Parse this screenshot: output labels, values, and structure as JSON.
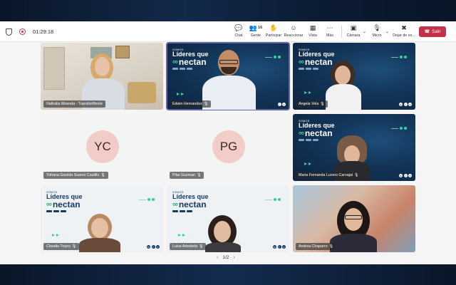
{
  "toolbar": {
    "timer": "01:29:18",
    "chat_label": "Chat",
    "people_count": "16",
    "people_label": "Gente",
    "raise_label": "Participar",
    "react_label": "Reaccionar",
    "view_label": "Vista",
    "more_label": "Más",
    "camera_label": "Cámara",
    "mic_label": "Micro",
    "share_label": "Dejar de co...",
    "leave_label": "Salir"
  },
  "brand": {
    "small": "SOMOS",
    "line1": "Líderes que",
    "line2": "nectan"
  },
  "participants": [
    {
      "name": "Nathalia Miranda - TransforMente",
      "type": "video"
    },
    {
      "name": "Edwin Hernandez",
      "type": "video"
    },
    {
      "name": "Angela Vela",
      "type": "video"
    },
    {
      "name": "Yohana Giselda Suarez Castillo",
      "type": "avatar",
      "initials": "YC"
    },
    {
      "name": "Pilar Guzman",
      "type": "avatar",
      "initials": "PG"
    },
    {
      "name": "Maria Fernanda Lucero Carvajal",
      "type": "video"
    },
    {
      "name": "Claudia Trejos",
      "type": "video"
    },
    {
      "name": "Luisa Arboleda",
      "type": "video"
    },
    {
      "name": "Andrea Chaparro",
      "type": "video"
    }
  ],
  "pagination": {
    "label": "1/2"
  },
  "colors": {
    "leave": "#c4314b",
    "active_outline": "#6264a7",
    "avatar_bg": "#f2ccc6"
  }
}
